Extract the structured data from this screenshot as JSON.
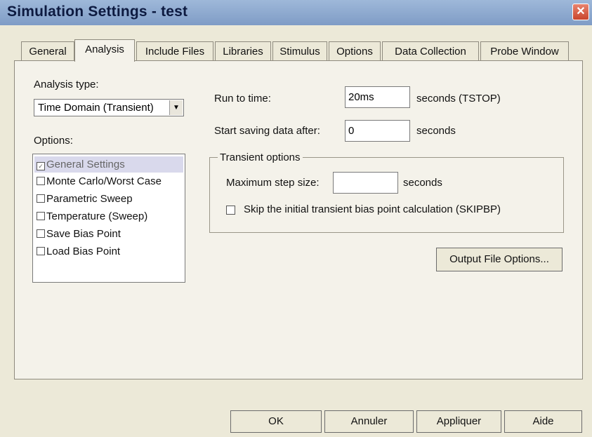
{
  "window": {
    "title": "Simulation Settings - test",
    "close_glyph": "✕"
  },
  "tabs": [
    {
      "label": "General"
    },
    {
      "label": "Analysis",
      "active": true
    },
    {
      "label": "Include Files"
    },
    {
      "label": "Libraries"
    },
    {
      "label": "Stimulus"
    },
    {
      "label": "Options"
    },
    {
      "label": "Data Collection"
    },
    {
      "label": "Probe Window"
    }
  ],
  "analysis_type": {
    "label": "Analysis type:",
    "value": "Time Domain (Transient)",
    "arrow": "▼"
  },
  "options": {
    "label": "Options:",
    "items": [
      {
        "label": "General Settings",
        "checked": true,
        "selected": true
      },
      {
        "label": "Monte Carlo/Worst Case",
        "checked": false
      },
      {
        "label": "Parametric Sweep",
        "checked": false
      },
      {
        "label": "Temperature (Sweep)",
        "checked": false
      },
      {
        "label": "Save Bias Point",
        "checked": false
      },
      {
        "label": "Load Bias Point",
        "checked": false
      }
    ]
  },
  "run_to_time": {
    "label": "Run to time:",
    "value": "20ms",
    "unit": "seconds  (TSTOP)"
  },
  "start_saving": {
    "label": "Start saving data after:",
    "value": "0",
    "unit": "seconds"
  },
  "transient": {
    "title": "Transient options",
    "max_step": {
      "label": "Maximum step size:",
      "value": "",
      "unit": "seconds"
    },
    "skip_bias": {
      "label": "Skip the initial transient bias point calculation  (SKIPBP)",
      "checked": false
    }
  },
  "output_file_options": "Output File Options...",
  "buttons": {
    "ok": "OK",
    "cancel": "Annuler",
    "apply": "Appliquer",
    "help": "Aide"
  }
}
